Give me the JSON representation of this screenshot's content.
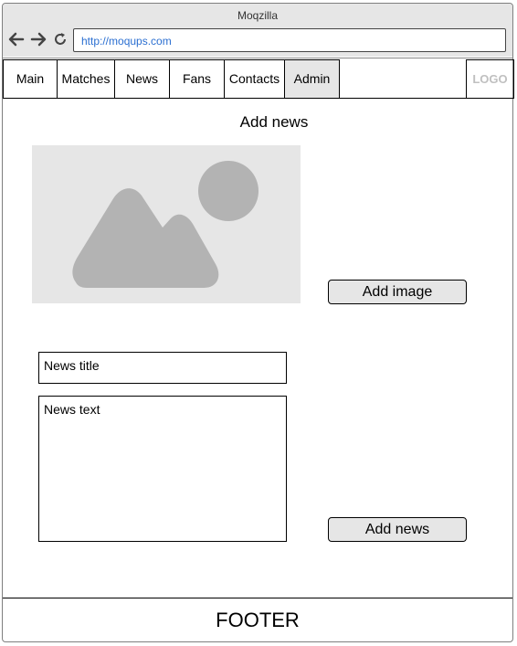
{
  "browser": {
    "title": "Moqzilla",
    "url": "http://moqups.com"
  },
  "nav": {
    "tabs": [
      {
        "label": "Main"
      },
      {
        "label": "Matches"
      },
      {
        "label": "News"
      },
      {
        "label": "Fans"
      },
      {
        "label": "Contacts"
      },
      {
        "label": "Admin",
        "active": true
      }
    ],
    "logo": "LOGO"
  },
  "main": {
    "title": "Add news",
    "image_placeholder": {
      "icon": "image-placeholder-icon"
    },
    "add_image_label": "Add image",
    "news_title_placeholder": "News title",
    "news_text_placeholder": "News text",
    "add_news_label": "Add news"
  },
  "footer": {
    "label": "FOOTER"
  },
  "colors": {
    "tab_active_bg": "#e6e6e6",
    "url": "#2b6fd1",
    "placeholder_bg": "#e6e6e6",
    "placeholder_icon": "#b3b3b3"
  }
}
